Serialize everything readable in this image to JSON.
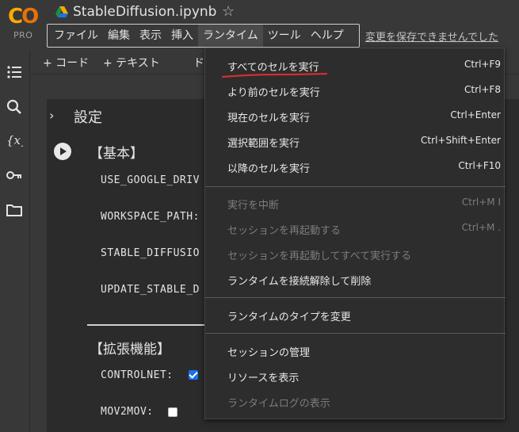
{
  "header": {
    "logo_text": "CO",
    "logo_badge": "PRO",
    "notebook_title": "StableDiffusion.ipynb",
    "save_notice": "変更を保存できませんでした"
  },
  "menubar": {
    "items": [
      {
        "label": "ファイル"
      },
      {
        "label": "編集"
      },
      {
        "label": "表示"
      },
      {
        "label": "挿入"
      },
      {
        "label": "ランタイム",
        "active": true
      },
      {
        "label": "ツール"
      },
      {
        "label": "ヘルプ"
      }
    ]
  },
  "toolbar": {
    "add_code": "+ コード",
    "add_text": "+ テキスト",
    "truncated": "ド"
  },
  "notebook": {
    "section_title": "設定",
    "basic_heading": "【基本】",
    "params_basic": [
      "USE_GOOGLE_DRIV",
      "WORKSPACE_PATH:",
      "STABLE_DIFFUSIO",
      "UPDATE_STABLE_D"
    ],
    "ext_heading": "【拡張機能】",
    "params_ext": [
      {
        "label": "CONTROLNET:",
        "checked": true
      },
      {
        "label": "MOV2MOV:",
        "checked": false
      }
    ]
  },
  "runtime_menu": {
    "items": [
      {
        "label": "すべてのセルを実行",
        "shortcut": "Ctrl+F9",
        "disabled": false
      },
      {
        "label": "より前のセルを実行",
        "shortcut": "Ctrl+F8",
        "disabled": false
      },
      {
        "label": "現在のセルを実行",
        "shortcut": "Ctrl+Enter",
        "disabled": false
      },
      {
        "label": "選択範囲を実行",
        "shortcut": "Ctrl+Shift+Enter",
        "disabled": false
      },
      {
        "label": "以降のセルを実行",
        "shortcut": "Ctrl+F10",
        "disabled": false
      },
      {
        "label": "実行を中断",
        "shortcut": "Ctrl+M I",
        "disabled": true
      },
      {
        "label": "セッションを再起動する",
        "shortcut": "Ctrl+M .",
        "disabled": true
      },
      {
        "label": "セッションを再起動してすべて実行する",
        "shortcut": "",
        "disabled": true
      },
      {
        "label": "ランタイムを接続解除して削除",
        "shortcut": "",
        "disabled": false
      },
      {
        "label": "ランタイムのタイプを変更",
        "shortcut": "",
        "disabled": false
      },
      {
        "label": "セッションの管理",
        "shortcut": "",
        "disabled": false
      },
      {
        "label": "リソースを表示",
        "shortcut": "",
        "disabled": false
      },
      {
        "label": "ランタイムログの表示",
        "shortcut": "",
        "disabled": true
      }
    ]
  },
  "colors": {
    "background": "#383838",
    "cell": "#2b2b2b",
    "menu": "#2d2d2d",
    "accent": "#1a73e8",
    "annotation": "#d32f2f"
  }
}
